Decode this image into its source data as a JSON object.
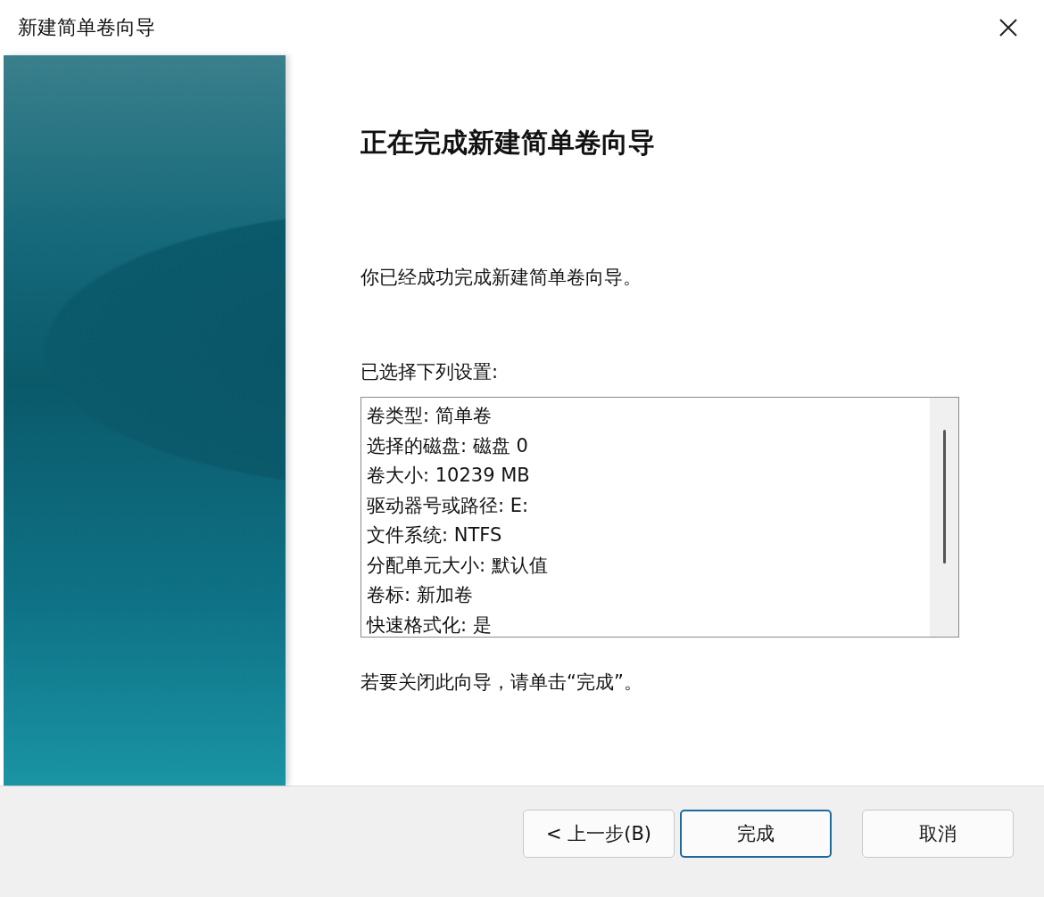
{
  "window": {
    "title": "新建简单卷向导"
  },
  "heading": "正在完成新建简单卷向导",
  "intro": "你已经成功完成新建简单卷向导。",
  "settings_label": "已选择下列设置:",
  "settings": [
    "卷类型: 简单卷",
    "选择的磁盘: 磁盘 0",
    "卷大小: 10239 MB",
    "驱动器号或路径: E:",
    "文件系统: NTFS",
    "分配单元大小: 默认值",
    "卷标: 新加卷",
    "快速格式化: 是"
  ],
  "closing_note": "若要关闭此向导，请单击“完成”。",
  "buttons": [
    {
      "label": "< 上一步(B)",
      "kind": "secondary"
    },
    {
      "label": "完成",
      "kind": "default"
    },
    {
      "label": "取消",
      "kind": "secondary"
    }
  ]
}
